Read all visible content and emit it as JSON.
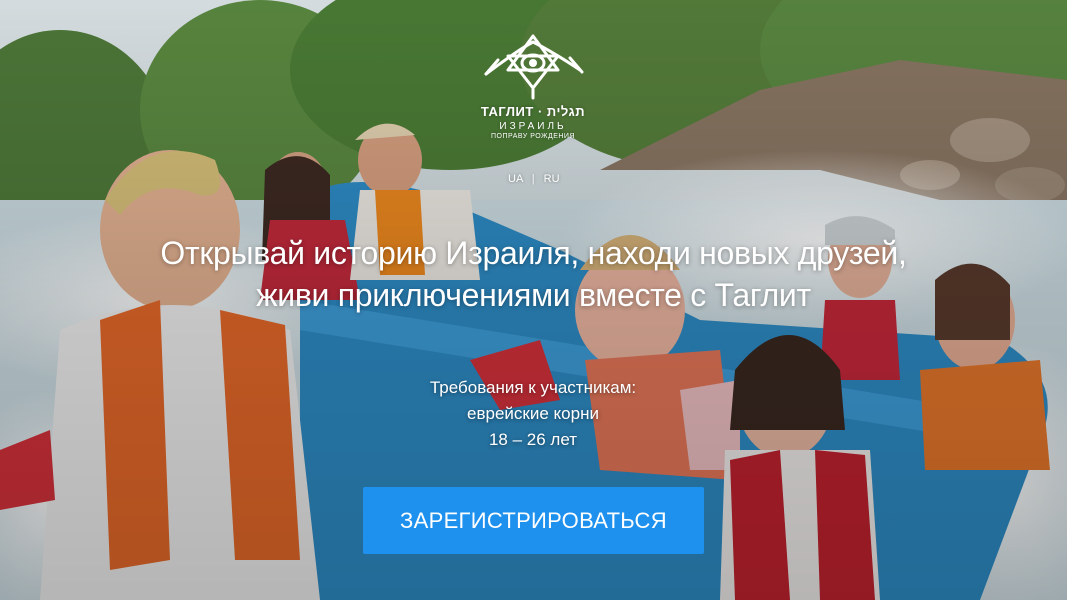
{
  "logo": {
    "brand_line": "ТАГЛИТ · תגלית",
    "country": "ИЗРАИЛЬ",
    "tagline": "ПОПРАВУ РОЖДЕНИЯ"
  },
  "language_switch": {
    "options": [
      "UA",
      "RU"
    ],
    "separator": "|"
  },
  "hero": {
    "headline_line1": "Открывай историю Израиля, находи новых друзей,",
    "headline_line2": "живи приключениями вместе с Таглит",
    "requirements_title": "Требования к участникам:",
    "requirement_1": "еврейские корни",
    "requirement_2": "18 – 26 лет",
    "photo_description": ""
  },
  "cta": {
    "label": "ЗАРЕГИСТРИРОВАТЬСЯ"
  },
  "colors": {
    "cta_background": "#1e90ee",
    "text": "#ffffff"
  }
}
